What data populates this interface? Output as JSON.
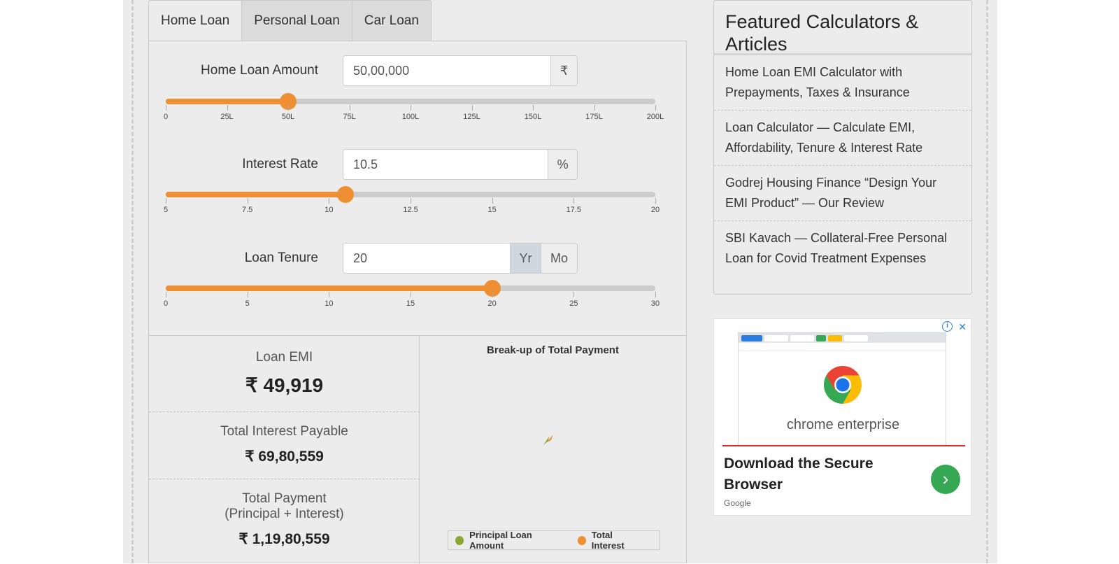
{
  "tabs": [
    "Home Loan",
    "Personal Loan",
    "Car Loan"
  ],
  "active_tab": "Home Loan",
  "loan_amount": {
    "label": "Home Loan Amount",
    "value": "50,00,000",
    "unit": "₹",
    "slider_value": 50,
    "slider_min": 0,
    "slider_max": 200,
    "ticks": [
      "0",
      "25L",
      "50L",
      "75L",
      "100L",
      "125L",
      "150L",
      "175L",
      "200L"
    ]
  },
  "interest_rate": {
    "label": "Interest Rate",
    "value": "10.5",
    "unit": "%",
    "slider_value": 10.5,
    "slider_min": 5,
    "slider_max": 20,
    "ticks": [
      "5",
      "7.5",
      "10",
      "12.5",
      "15",
      "17.5",
      "20"
    ]
  },
  "tenure": {
    "label": "Loan Tenure",
    "value": "20",
    "unit_year": "Yr",
    "unit_month": "Mo",
    "selected_unit": "Yr",
    "slider_value": 20,
    "slider_min": 0,
    "slider_max": 30,
    "ticks": [
      "0",
      "5",
      "10",
      "15",
      "20",
      "25",
      "30"
    ]
  },
  "results": {
    "emi_label": "Loan EMI",
    "emi_value": "₹ 49,919",
    "interest_label": "Total Interest Payable",
    "interest_value": "₹ 69,80,559",
    "total_label_1": "Total Payment",
    "total_label_2": "(Principal + Interest)",
    "total_value": "₹ 1,19,80,559"
  },
  "chart": {
    "title": "Break-up of Total Payment",
    "legend": [
      {
        "name": "Principal Loan Amount",
        "color": "#88a82f"
      },
      {
        "name": "Total Interest",
        "color": "#ee8f34"
      }
    ]
  },
  "featured": {
    "title": "Featured Calculators & Articles",
    "items": [
      "Home Loan EMI Calculator with Prepayments, Taxes & Insurance",
      "Loan Calculator — Calculate EMI, Affordability, Tenure & Interest Rate",
      "Godrej Housing Finance “Design Your EMI Product” — Our Review",
      "SBI Kavach — Collateral-Free Personal Loan for Covid Treatment Expenses"
    ]
  },
  "ad": {
    "brand": "chrome enterprise",
    "headline": "Download the Secure Browser",
    "advertiser": "Google",
    "info_icon": "info-icon",
    "close_icon": "close-icon"
  },
  "colors": {
    "accent": "#ee8f34",
    "principal": "#88a82f",
    "track": "#cccccc"
  }
}
